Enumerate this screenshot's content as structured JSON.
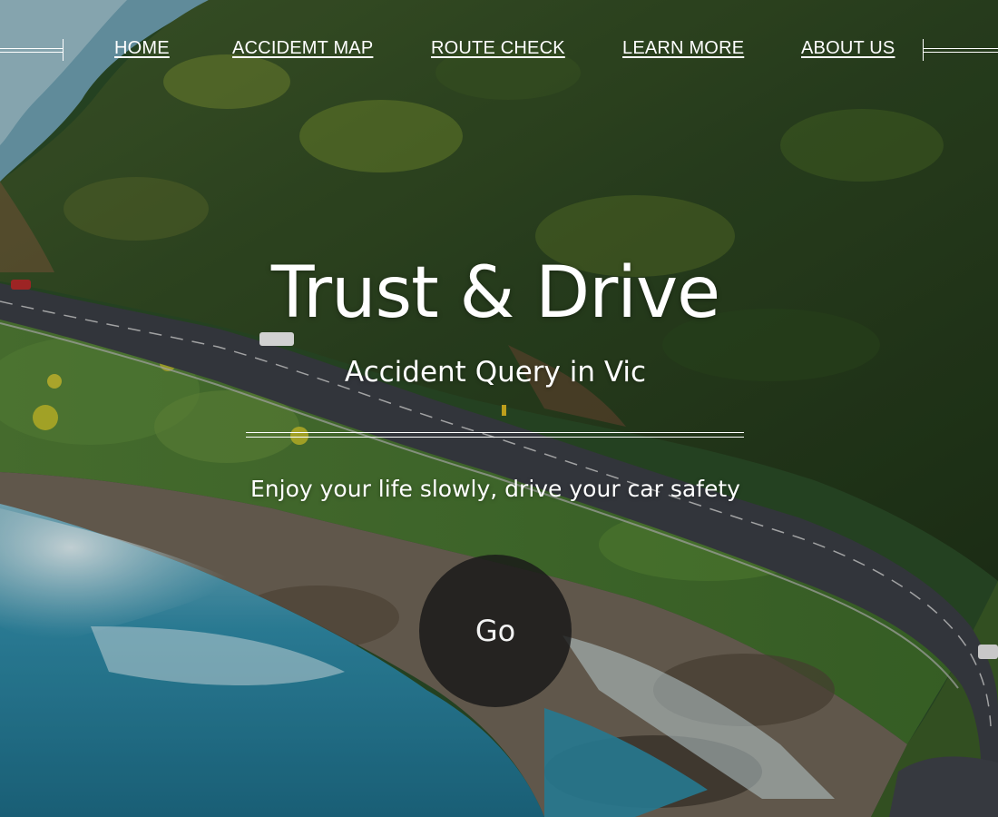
{
  "nav": {
    "items": [
      {
        "label": "HOME"
      },
      {
        "label": "ACCIDEMT MAP"
      },
      {
        "label": "ROUTE CHECK"
      },
      {
        "label": "LEARN MORE"
      },
      {
        "label": "ABOUT US"
      }
    ]
  },
  "hero": {
    "title": "Trust & Drive",
    "subtitle": "Accident Query in Vic",
    "tagline": "Enjoy your life slowly, drive your car safety",
    "button_label": "Go",
    "background": {
      "description_icon": "coastal-road-photo",
      "forest_color": "#2f4a1f",
      "ocean_color": "#2f8aa6",
      "road_color": "#3a3d44"
    }
  },
  "colors": {
    "text": "#ffffff",
    "button_bg": "#181818"
  }
}
